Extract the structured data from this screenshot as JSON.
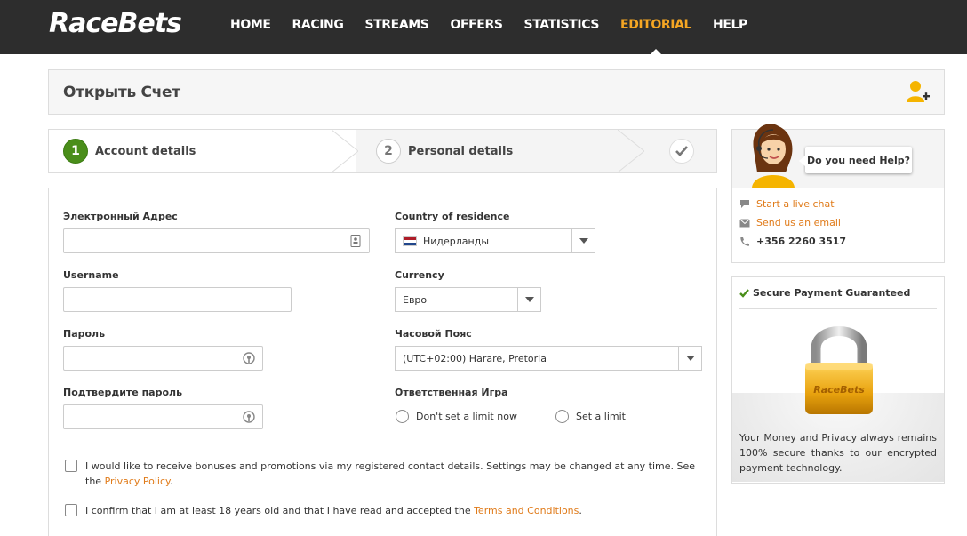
{
  "brand": {
    "logo": "RaceBets",
    "accent": "#f5a623",
    "link_color": "#e07b1a",
    "success": "#4a8e1a"
  },
  "nav": {
    "items": [
      {
        "label": "HOME"
      },
      {
        "label": "RACING"
      },
      {
        "label": "STREAMS"
      },
      {
        "label": "OFFERS"
      },
      {
        "label": "STATISTICS"
      },
      {
        "label": "EDITORIAL",
        "active": true
      },
      {
        "label": "HELP"
      }
    ]
  },
  "page": {
    "title": "Открыть Счет",
    "title_icon": "add-user-icon"
  },
  "steps": [
    {
      "number": "1",
      "label": "Account details",
      "active": true
    },
    {
      "number": "2",
      "label": "Personal details"
    },
    {
      "icon": "checkmark-icon"
    }
  ],
  "form": {
    "email": {
      "label": "Электронный Адрес",
      "value": "",
      "icon": "contact-card-icon"
    },
    "username": {
      "label": "Username",
      "value": ""
    },
    "password": {
      "label": "Пароль",
      "value": "",
      "icon": "password-key-icon"
    },
    "password_confirm": {
      "label": "Подтвердите пароль",
      "value": "",
      "icon": "password-key-icon"
    },
    "country": {
      "label": "Country of residence",
      "value": "Нидерланды",
      "icon": "netherlands-flag-icon"
    },
    "currency": {
      "label": "Currency",
      "value": "Евро"
    },
    "timezone": {
      "label": "Часовой Пояс",
      "value": "(UTC+02:00) Harare, Pretoria"
    },
    "responsible_gaming": {
      "label": "Ответственная Игра",
      "options": [
        {
          "label": "Don't set a limit now",
          "selected": false
        },
        {
          "label": "Set a limit",
          "selected": false
        }
      ]
    },
    "consent_bonus": {
      "text": "I would like to receive bonuses and promotions via my registered contact details. Settings may be changed at any time. See the ",
      "link": "Privacy Policy",
      "suffix": ".",
      "checked": false
    },
    "consent_terms": {
      "text": "I confirm that I am at least 18 years old and that I have read and accepted the ",
      "link": "Terms and Conditions",
      "suffix": ".",
      "checked": false
    }
  },
  "help": {
    "bubble": "Do you need Help?",
    "live_chat": "Start a live chat",
    "email": "Send us an email",
    "phone": "+356 2260 3517"
  },
  "secure": {
    "title": "Secure Payment Guaranteed",
    "lock_label": "RaceBets",
    "text": "Your Money and Privacy always remains 100% secure thanks to our encrypted payment technology."
  }
}
